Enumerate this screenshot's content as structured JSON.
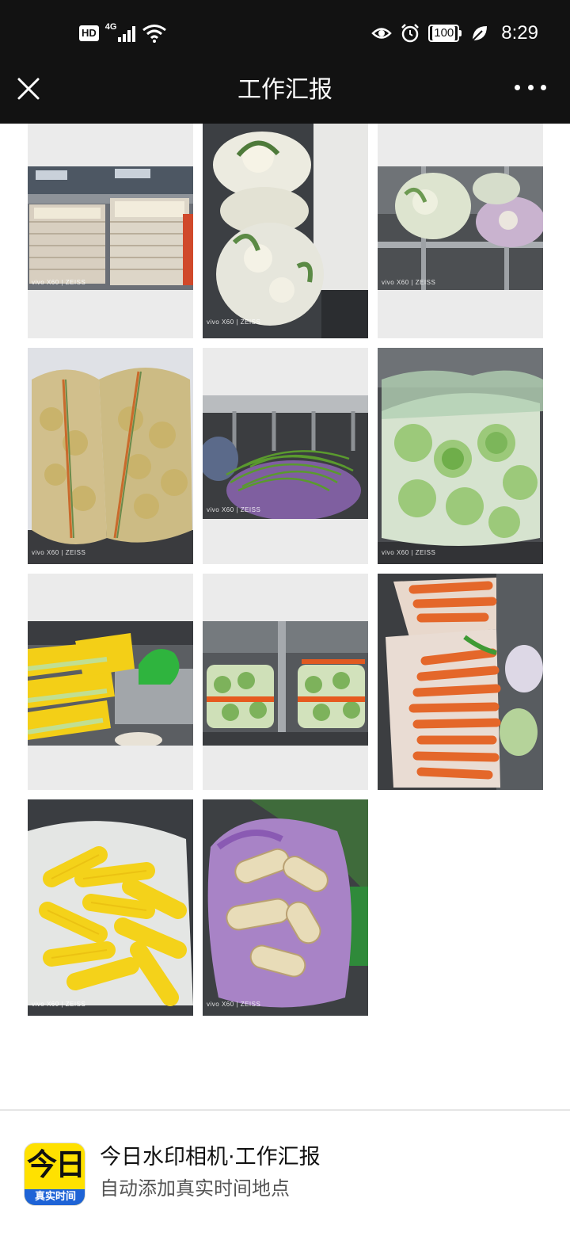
{
  "status_bar": {
    "hd": "HD",
    "network": "4G",
    "battery": "100",
    "time": "8:29",
    "icons": [
      "signal-icon",
      "wifi-icon",
      "eye-icon",
      "alarm-icon",
      "battery-icon",
      "leaf-icon"
    ]
  },
  "nav": {
    "title": "工作汇报",
    "close_icon": "close-icon",
    "more_icon": "more-icon"
  },
  "photos": [
    {
      "subject": "white trays stacked on carts",
      "watermark": "vivo X60 | ZEISS"
    },
    {
      "subject": "cauliflower in mesh bags",
      "watermark": "vivo X60 | ZEISS"
    },
    {
      "subject": "cauliflower bags on steel rack",
      "watermark": "vivo X60 | ZEISS"
    },
    {
      "subject": "potatoes in mesh sacks",
      "watermark": "vivo X60 | ZEISS"
    },
    {
      "subject": "long green beans in purple bag",
      "watermark": "vivo X60 | ZEISS"
    },
    {
      "subject": "cabbages in mesh bag",
      "watermark": "vivo X60 | ZEISS"
    },
    {
      "subject": "yellow packaged noodles",
      "watermark": ""
    },
    {
      "subject": "napa cabbage bundles",
      "watermark": ""
    },
    {
      "subject": "carrots in plastic bag",
      "watermark": ""
    },
    {
      "subject": "yellow corn in plastic bag",
      "watermark": "vivo X60 | ZEISS"
    },
    {
      "subject": "lotus root in purple bag",
      "watermark": "vivo X60 | ZEISS"
    }
  ],
  "banner": {
    "logo_text": "今日",
    "logo_strip": "真实时间",
    "title": "今日水印相机·工作汇报",
    "subtitle": "自动添加真实时间地点"
  },
  "colors": {
    "status_bar_bg": "#121212",
    "placeholder_bg": "#ebebeb",
    "logo_yellow": "#ffe100",
    "logo_blue": "#1e63d6"
  }
}
